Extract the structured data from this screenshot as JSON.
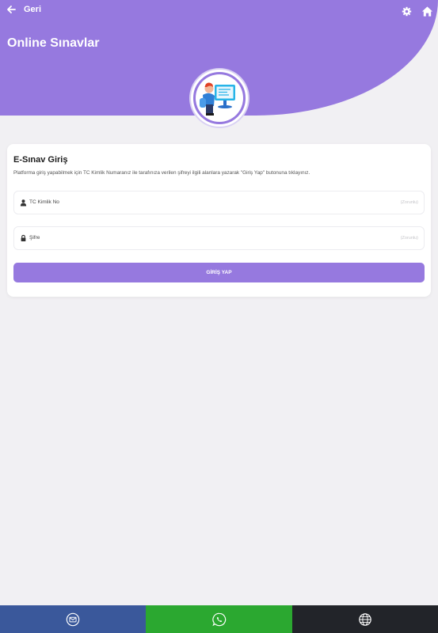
{
  "header": {
    "back_label": "Geri",
    "title": "Online Sınavlar",
    "icons": [
      "back-arrow-icon",
      "gear-icon",
      "home-icon"
    ]
  },
  "login_card": {
    "title": "E-Sınav Giriş",
    "description": "Platforma giriş yapabilmek için TC Kimlik Numaranız ile tarafınıza verilen şifreyi ilgili alanlara yazarak \"Giriş Yap\" butonuna tıklayınız.",
    "tc_field": {
      "placeholder": "TC Kimlik No",
      "hint": "(Zorunlu)",
      "value": ""
    },
    "password_field": {
      "placeholder": "Şifre",
      "hint": "(Zorunlu)",
      "value": ""
    },
    "submit_label": "GİRİŞ YAP"
  },
  "bottom_bar": {
    "items": [
      {
        "icon": "mail-icon",
        "color": "#3a589b"
      },
      {
        "icon": "whatsapp-icon",
        "color": "#2ba830"
      },
      {
        "icon": "globe-icon",
        "color": "#222429"
      }
    ]
  },
  "colors": {
    "accent": "#9679df",
    "background": "#f1f0f3"
  }
}
